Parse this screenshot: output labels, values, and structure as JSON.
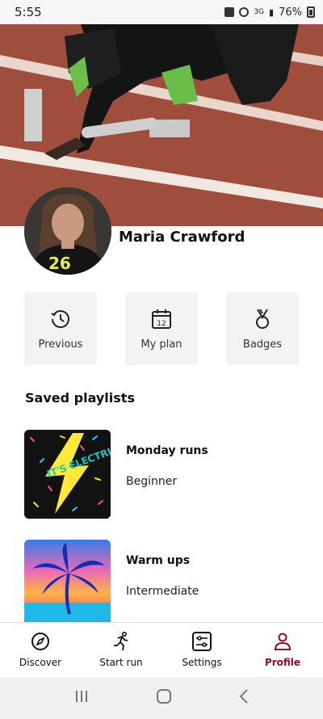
{
  "status_bar": {
    "time": "5:55",
    "battery": "76%",
    "network": "3G"
  },
  "profile": {
    "name": "Maria Crawford",
    "jersey_number": "26"
  },
  "quick_actions": [
    {
      "label": "Previous",
      "icon": "history-icon"
    },
    {
      "label": "My plan",
      "icon": "calendar-icon",
      "calendar_day": "12"
    },
    {
      "label": "Badges",
      "icon": "medal-icon"
    }
  ],
  "saved_playlists": {
    "title": "Saved playlists",
    "items": [
      {
        "name": "Monday runs",
        "level": "Beginner",
        "art_text": "IT'S ELECTRIC"
      },
      {
        "name": "Warm ups",
        "level": "Intermediate"
      }
    ]
  },
  "bottom_nav": {
    "items": [
      {
        "label": "Discover",
        "icon": "compass-icon",
        "active": false
      },
      {
        "label": "Start run",
        "icon": "runner-icon",
        "active": false
      },
      {
        "label": "Settings",
        "icon": "sliders-icon",
        "active": false
      },
      {
        "label": "Profile",
        "icon": "person-icon",
        "active": true
      }
    ]
  },
  "colors": {
    "accent": "#8b0a2e",
    "card_bg": "#f3f3f3",
    "track": "#a85443"
  }
}
